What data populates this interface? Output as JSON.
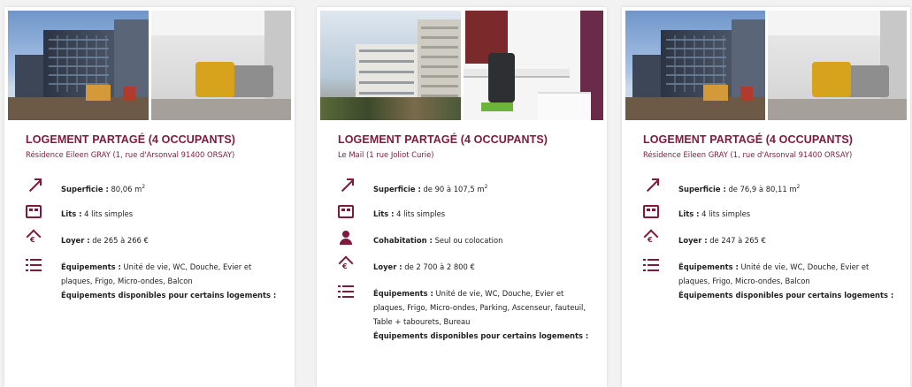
{
  "cards": [
    {
      "title": "LOGEMENT PARTAGÉ (4 OCCUPANTS)",
      "address": "Résidence Eileen GRAY (1, rue d'Arsonval 91400 ORSAY)",
      "superficie_label": "Superficie :",
      "superficie_value": "80,06 m",
      "superficie_unit_exp": "2",
      "lits_label": "Lits :",
      "lits_value": "4 lits simples",
      "loyer_label": "Loyer :",
      "loyer_value": "de 265 à 266 €",
      "equipements_label": "Équipements :",
      "equipements_value": "Unité de vie, WC, Douche, Evier et plaques, Frigo, Micro-ondes, Balcon",
      "dispo_label": "Équipements disponibles pour certains logements :"
    },
    {
      "title": "LOGEMENT PARTAGÉ (4 OCCUPANTS)",
      "address": "Le Mail (1 rue Joliot Curie)",
      "superficie_label": "Superficie :",
      "superficie_value": "de 90 à 107,5 m",
      "superficie_unit_exp": "2",
      "lits_label": "Lits :",
      "lits_value": "4 lits simples",
      "cohabitation_label": "Cohabitation :",
      "cohabitation_value": "Seul ou colocation",
      "loyer_label": "Loyer :",
      "loyer_value": "de 2 700 à 2 800 €",
      "equipements_label": "Équipements :",
      "equipements_value": "Unité de vie, WC, Douche, Evier et plaques, Frigo, Micro-ondes, Parking, Ascenseur, fauteuil, Table + tabourets, Bureau",
      "dispo_label": "Équipements disponibles pour certains logements :"
    },
    {
      "title": "LOGEMENT PARTAGÉ (4 OCCUPANTS)",
      "address": "Résidence Eileen GRAY (1, rue d'Arsonval 91400 ORSAY)",
      "superficie_label": "Superficie :",
      "superficie_value": "de 76,9 à 80,11 m",
      "superficie_unit_exp": "2",
      "lits_label": "Lits :",
      "lits_value": "4 lits simples",
      "loyer_label": "Loyer :",
      "loyer_value": "de 247 à 265 €",
      "equipements_label": "Équipements :",
      "equipements_value": "Unité de vie, WC, Douche, Evier et plaques, Frigo, Micro-ondes, Balcon",
      "dispo_label": "Équipements disponibles pour certains logements :"
    }
  ],
  "colors": {
    "accent": "#7e1a3c",
    "text": "#222222",
    "background": "#f2f2f2"
  },
  "icons": [
    "area-arrow-icon",
    "bed-icon",
    "person-icon",
    "house-euro-icon",
    "list-icon"
  ]
}
